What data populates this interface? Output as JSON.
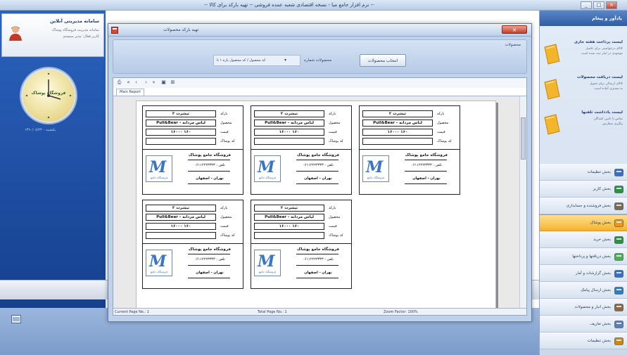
{
  "app": {
    "title": "-- نرم افزار جامع مبا - نسخه اقتصادی شعبه عمده فروشی -- تهیه بارکد برای کالا --",
    "window_controls": [
      "_",
      "□",
      "×"
    ]
  },
  "user_card": {
    "name": "سامانه مدیریتی آنلاین",
    "detail_1": "سامانه مدیریت فروشگاه پوشاک",
    "detail_2": "کاربر فعال: مدیر سیستم"
  },
  "clock": {
    "brand": "فروشگاه پوشاک",
    "date": "۱۳۹۰/۰۸/۲۴ - یکشنبه"
  },
  "right_panel": {
    "header": "یادآور و پیغام",
    "notes": [
      {
        "title": "لیست پرداخت هفته جاری",
        "line1": "کالای درخواستی برای تکمیل",
        "line2": "موجودی در انبار ثبت شده است"
      },
      {
        "title": "لیست دریافت محصولات",
        "line1": "کالای ارسالی برای تحویل",
        "line2": "به مشتری آماده است"
      },
      {
        "title": "لیست یادداشت تلفنها",
        "line1": "تماس با تامین کنندگان",
        "line2": "پیگیری سفارش"
      }
    ],
    "menu": [
      {
        "label": "بخش تنظیمات",
        "icon": "settings-icon",
        "active": false
      },
      {
        "label": "بخش کاربر",
        "icon": "user-icon",
        "active": false
      },
      {
        "label": "بخش فروشنده و حسابداری",
        "icon": "tools-icon",
        "active": false
      },
      {
        "label": "بخش پوشاک",
        "icon": "clothes-icon",
        "active": true
      },
      {
        "label": "بخش خرید",
        "icon": "cart-icon",
        "active": false
      },
      {
        "label": "بخش دریافتها و پرداختها",
        "icon": "plus-icon",
        "active": false
      },
      {
        "label": "بخش گزارشات و آمار",
        "icon": "chart-icon",
        "active": false
      },
      {
        "label": "بخش ارسال پیامک",
        "icon": "sms-icon",
        "active": false
      },
      {
        "label": "بخش انبار و محصولات",
        "icon": "warehouse-icon",
        "active": false
      },
      {
        "label": "بخش تعاریف",
        "icon": "define-icon",
        "active": false
      },
      {
        "label": "بخش تنظیمات",
        "icon": "gear-icon",
        "active": false
      }
    ]
  },
  "dialog": {
    "title": "تهیه بارکد محصولات",
    "filter_section_label": "محصولات",
    "show_button": "انتخاب محصولات",
    "range_label": "محصولات شماره",
    "range_value": "کد محصول / کد محصول بازه ۱ تا",
    "view_tab": "Main Report",
    "status": {
      "current_page": "Current Page No.: 1",
      "total_pages": "Total Page No.: 1",
      "zoom": "Zoom Factor: 100%"
    }
  },
  "label_fields": {
    "code": "بارکد",
    "product": "محصول",
    "price": "قیمت",
    "extra": "کد پوشاک"
  },
  "labels": [
    {
      "code": "تیشرت ۲",
      "product": "Pull&Bear - لباس مردانه",
      "price": "۱۶۰۰۰ ۱۶۰",
      "extra": "",
      "shop": "فروشگاه جامع پوشاک",
      "phone": "۰۶۱۱۲۲۲۳۳۳۳ : تلفن",
      "city": "تهران - اصفهان"
    },
    {
      "code": "تیشرت ۲",
      "product": "Pull&Bear - لباس مردانه",
      "price": "۱۶۰۰۰ ۱۶۰",
      "extra": "",
      "shop": "فروشگاه جامع پوشاک",
      "phone": "۰۶۱۱۲۲۲۳۳۳۳ : تلفن",
      "city": "تهران - اصفهان"
    },
    {
      "code": "تیشرت ۲",
      "product": "Pull&Bear - لباس مردانه",
      "price": "۱۶۰۰۰ ۱۶۰",
      "extra": "",
      "shop": "فروشگاه جامع پوشاک",
      "phone": "۰۶۱۱۲۲۲۳۳۳۳ : تلفن",
      "city": "تهران - اصفهان"
    },
    {
      "code": "تیشرت ۲",
      "product": "Pull&Bear - لباس مردانه",
      "price": "۱۶۰۰۰ ۱۶۰",
      "extra": "",
      "shop": "فروشگاه جامع پوشاک",
      "phone": "۰۶۱۱۲۲۲۳۳۳۳ : تلفن",
      "city": "تهران - اصفهان"
    },
    {
      "code": "تیشرت ۲",
      "product": "Pull&Bear - لباس مردانه",
      "price": "۱۶۰۰۰ ۱۶۰",
      "extra": "",
      "shop": "فروشگاه جامع پوشاک",
      "phone": "۰۶۱۱۲۲۲۳۳۳۳ : تلفن",
      "city": "تهران - اصفهان"
    }
  ],
  "logo_text": "فروشگاه جامع"
}
